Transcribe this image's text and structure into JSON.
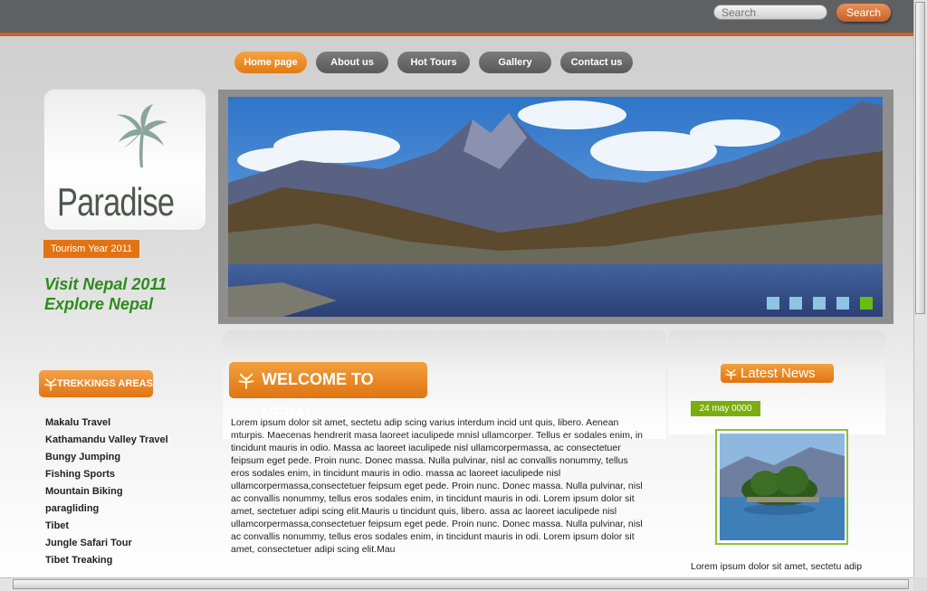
{
  "search": {
    "placeholder": "Search",
    "button_label": "Search"
  },
  "nav": {
    "items": [
      {
        "label": "Home page",
        "active": true
      },
      {
        "label": "About us"
      },
      {
        "label": "Hot Tours"
      },
      {
        "label": "Gallery"
      },
      {
        "label": "Contact us"
      }
    ]
  },
  "logo": {
    "text": "Paradise"
  },
  "sidebar": {
    "badge": "Tourism Year 2011",
    "tagline_line1": "Visit Nepal 2011",
    "tagline_line2": "Explore Nepal",
    "trekking_heading": "TREKKINGS AREAS",
    "trekking_items": [
      "Makalu Travel",
      "Kathamandu Valley Travel",
      "Bungy Jumping",
      "Fishing Sports",
      "Mountain Biking",
      "paragliding",
      "Tibet",
      "Jungle Safari Tour",
      "Tibet Treaking"
    ]
  },
  "banner": {
    "slide_count": 5,
    "active_slide": 5
  },
  "welcome": {
    "heading": "WELCOME TO NEPAL",
    "body": "Lorem ipsum dolor sit amet, sectetu adip scing varius interdum incid unt quis, libero. Aenean mturpis. Maecenas hendrerit masa laoreet iaculipede mnisl ullamcorper. Tellus er sodales enim, in tincidunt mauris in odio. Massa ac laoreet iaculipede nisl ullamcorpermassa, ac consectetuer feipsum eget pede. Proin nunc. Donec massa. Nulla pulvinar, nisl ac convallis nonummy, tellus eros sodales enim, in tincidunt mauris in odio. massa ac laoreet iaculipede nisl ullamcorpermassa,consectetuer feipsum eget pede. Proin nunc. Donec massa. Nulla pulvinar, nisl ac convallis nonummy, tellus eros sodales enim, in tincidunt mauris in odi. Lorem ipsum dolor sit amet, sectetuer adipi scing elit.Mauris u tincidunt quis, libero. assa ac laoreet iaculipede nisl ullamcorpermassa,consectetuer feipsum eget pede. Proin nunc. Donec massa. Nulla pulvinar, nisl ac convallis nonummy, tellus eros sodales enim, in tincidunt mauris in odi. Lorem ipsum dolor sit amet, consectetuer adipi scing elit.Mau"
  },
  "news": {
    "heading": "Latest News",
    "date": "24 may 0000",
    "excerpt": "Lorem ipsum dolor sit amet, sectetu adip"
  },
  "colors": {
    "accent_orange": "#e27312",
    "accent_green": "#7aae0e",
    "tagline_green": "#2e8b1c",
    "topbar_gray": "#5f6062"
  }
}
